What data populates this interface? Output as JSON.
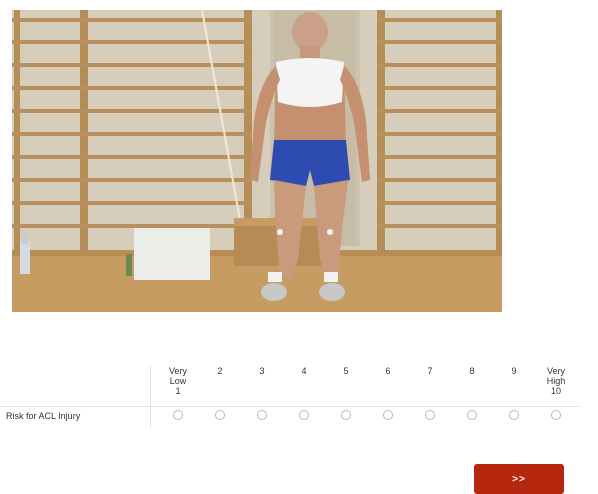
{
  "video": {
    "description": ""
  },
  "survey": {
    "row_label": "Risk for ACL Injury",
    "scale": [
      {
        "top": "Very",
        "mid": "Low",
        "num": "1"
      },
      {
        "top": "",
        "mid": "",
        "num": "2"
      },
      {
        "top": "",
        "mid": "",
        "num": "3"
      },
      {
        "top": "",
        "mid": "",
        "num": "4"
      },
      {
        "top": "",
        "mid": "",
        "num": "5"
      },
      {
        "top": "",
        "mid": "",
        "num": "6"
      },
      {
        "top": "",
        "mid": "",
        "num": "7"
      },
      {
        "top": "",
        "mid": "",
        "num": "8"
      },
      {
        "top": "",
        "mid": "",
        "num": "9"
      },
      {
        "top": "Very",
        "mid": "High",
        "num": "10"
      }
    ],
    "selected": null
  },
  "nav": {
    "next_label": ">>"
  },
  "colors": {
    "button": "#b5280f",
    "radio_border": "#b9b9b9"
  }
}
